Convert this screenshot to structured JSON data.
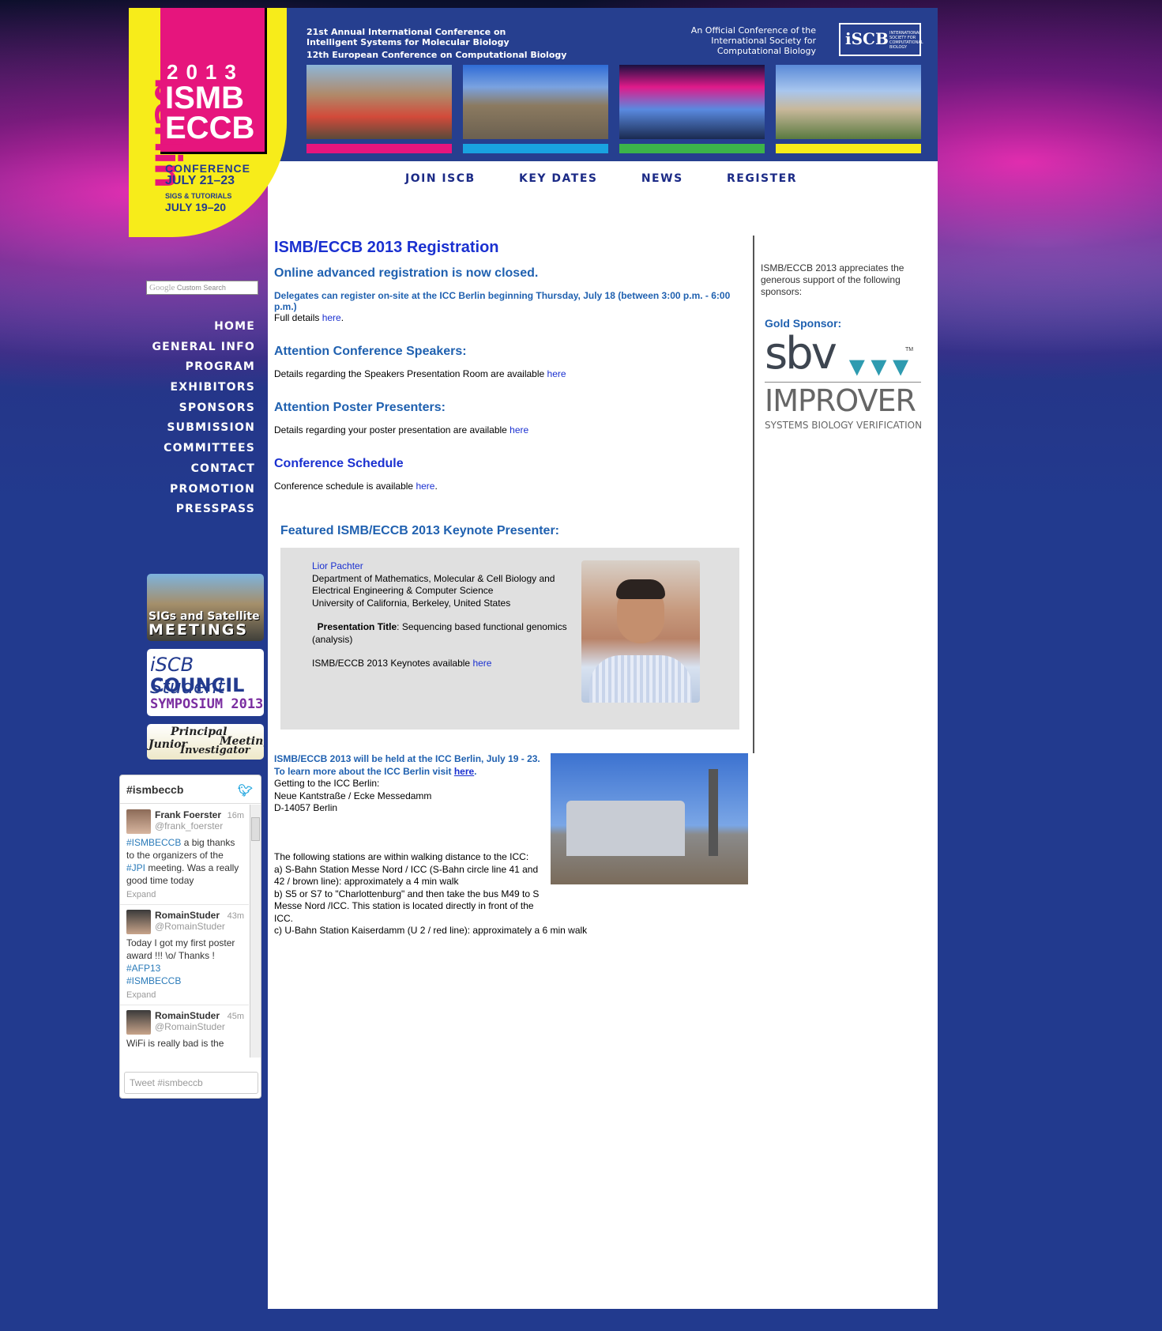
{
  "header": {
    "logo": {
      "year": "2013",
      "line1": "ISMB",
      "line2": "ECCB",
      "city": "berlin",
      "conference": "CONFERENCE",
      "conference_dates": "JULY 21–23",
      "sigs": "SIGS & TUTORIALS",
      "sigs_dates": "JULY 19–20"
    },
    "title_line1": "21st Annual International Conference on",
    "title_line2": "Intelligent Systems for Molecular Biology",
    "title_line3": "12th European Conference on Computational Biology",
    "official_line1": "An Official Conference of the",
    "official_line2": "International Society for",
    "official_line3": "Computational Biology",
    "iscb_badge": "iSCB",
    "iscb_badge_small": "INTERNATIONAL SOCIETY FOR COMPUTATIONAL BIOLOGY",
    "photo_strip_colors": [
      "#e6157d",
      "#19a3e0",
      "#3cb44a",
      "#f7ec1a"
    ]
  },
  "top_nav": [
    "JOIN ISCB",
    "KEY DATES",
    "NEWS",
    "REGISTER"
  ],
  "search": {
    "brand": "Google",
    "placeholder": "Custom Search"
  },
  "left_nav": [
    "HOME",
    "GENERAL INFO",
    "PROGRAM",
    "EXHIBITORS",
    "SPONSORS",
    "SUBMISSION",
    "COMMITTEES",
    "CONTACT",
    "PROMOTION",
    "PRESSPASS"
  ],
  "banners": {
    "sigs_line1": "SIGs and Satellite",
    "sigs_line2": "MEETINGS",
    "student_line1": "iSCB Student",
    "student_line2": "COUNCIL",
    "student_line3": "SYMPOSIUM 2013",
    "junior_word1": "Junior",
    "junior_word2": "Principal",
    "junior_word3": "Investigator",
    "junior_word4": "Meeting"
  },
  "twitter": {
    "header": "#ismbeccb",
    "tweets": [
      {
        "name": "Frank Foerster",
        "time": "16m",
        "handle": "@frank_foerster",
        "text_a": "#ISMBECCB",
        "text_b": " a big thanks to the organizers of the ",
        "text_c": "#JPI",
        "text_d": " meeting. Was a really good time today",
        "expand": "Expand"
      },
      {
        "name": "RomainStuder",
        "time": "43m",
        "handle": "@RomainStuder",
        "text_a": "Today I got my first poster award !!! \\o/ Thanks ! ",
        "text_b": "#AFP13",
        "text_c": "#ISMBECCB",
        "expand": "Expand"
      },
      {
        "name": "RomainStuder",
        "time": "45m",
        "handle": "@RomainStuder",
        "text_a": "WiFi is really bad is the"
      }
    ],
    "input_placeholder": "Tweet #ismbeccb"
  },
  "main": {
    "title": "ISMB/ECCB 2013 Registration",
    "closed": "Online advanced registration is now closed.",
    "onsite": "Delegates can register on-site at the ICC Berlin beginning Thursday, July 18 (between 3:00 p.m. - 6:00 p.m.)",
    "full_details": "Full details ",
    "here": "here",
    "speakers_head": "Attention Conference Speakers:",
    "speakers_text": "Details regarding the Speakers Presentation Room are available ",
    "poster_head": "Attention Poster Presenters:",
    "poster_text": "Details regarding your poster presentation are available ",
    "schedule_head": "Conference Schedule",
    "schedule_text": "Conference schedule is available ",
    "keynote_head": "Featured ISMB/ECCB 2013 Keynote Presenter:",
    "keynote": {
      "name": "Lior Pachter",
      "dept_line1": "Department of Mathematics, Molecular & Cell Biology and",
      "dept_line2": "Electrical Engineering & Computer Science",
      "univ": "University of California, Berkeley, United States",
      "pres_label": "Presentation Title",
      "pres_title": ": Sequencing based functional genomics (analysis)",
      "keynotes_text": "ISMB/ECCB 2013 Keynotes available "
    },
    "icc": {
      "held": "ISMB/ECCB 2013 will be held at the ICC Berlin, July 19 - 23. To learn more about the ICC Berlin visit ",
      "getting": "Getting to the ICC Berlin:",
      "addr1": "Neue Kantstraße / Ecke Messedamm",
      "addr2": "D-14057 Berlin",
      "stations": "The following stations are within walking distance to the ICC:",
      "a": "a) S-Bahn Station Messe Nord / ICC (S-Bahn circle line 41 and 42 / brown line): approximately a 4 min walk",
      "b": "b) S5 or S7 to \"Charlottenburg\" and then take the bus M49 to S Messe Nord /ICC. This station is located directly in front of the ICC.",
      "c": "c) U-Bahn Station Kaiserdamm (U 2 / red line): approximately a 6 min walk"
    }
  },
  "sponsor": {
    "intro": "ISMB/ECCB 2013 appreciates the generous support of the following sponsors:",
    "gold_label": "Gold Sponsor:",
    "logo_line1": "sbv",
    "logo_line2": "IMPROVER",
    "logo_line3": "SYSTEMS BIOLOGY VERIFICATION",
    "logo_tm": "TM"
  }
}
